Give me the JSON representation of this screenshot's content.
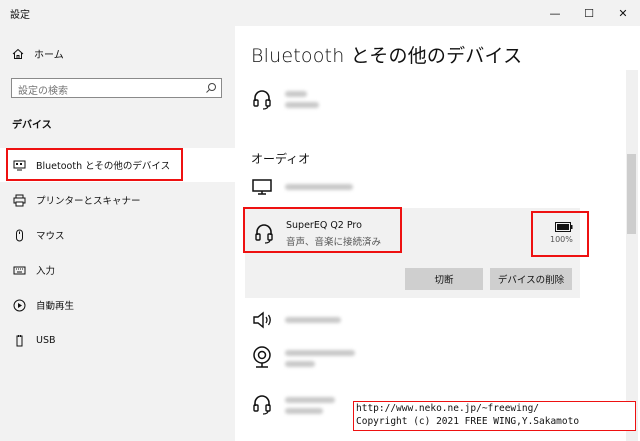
{
  "window": {
    "title": "設定",
    "minimize": "—",
    "maximize": "☐",
    "close": "✕"
  },
  "sidebar": {
    "home_label": "ホーム",
    "search_placeholder": "設定の検索",
    "section": "デバイス",
    "items": [
      {
        "label": "Bluetooth とその他のデバイス",
        "icon": "bluetooth-devices-icon"
      },
      {
        "label": "プリンターとスキャナー",
        "icon": "printer-icon"
      },
      {
        "label": "マウス",
        "icon": "mouse-icon"
      },
      {
        "label": "入力",
        "icon": "keyboard-icon"
      },
      {
        "label": "自動再生",
        "icon": "autoplay-icon"
      },
      {
        "label": "USB",
        "icon": "usb-icon"
      }
    ]
  },
  "main": {
    "title": "Bluetooth とその他のデバイス",
    "audio_header": "オーディオ",
    "selected_device": {
      "name": "SuperEQ Q2 Pro",
      "status": "音声、音楽に接続済み",
      "battery": "100%",
      "battery_level": 1.0,
      "disconnect_label": "切断",
      "remove_label": "デバイスの削除"
    }
  },
  "copyright": {
    "line1": "http://www.neko.ne.jp/~freewing/",
    "line2": "Copyright (c) 2021 FREE WING,Y.Sakamoto"
  },
  "colors": {
    "highlight": "#ee1111",
    "sidebar_bg": "#f2f2f2",
    "button_bg": "#cfcfcf"
  }
}
